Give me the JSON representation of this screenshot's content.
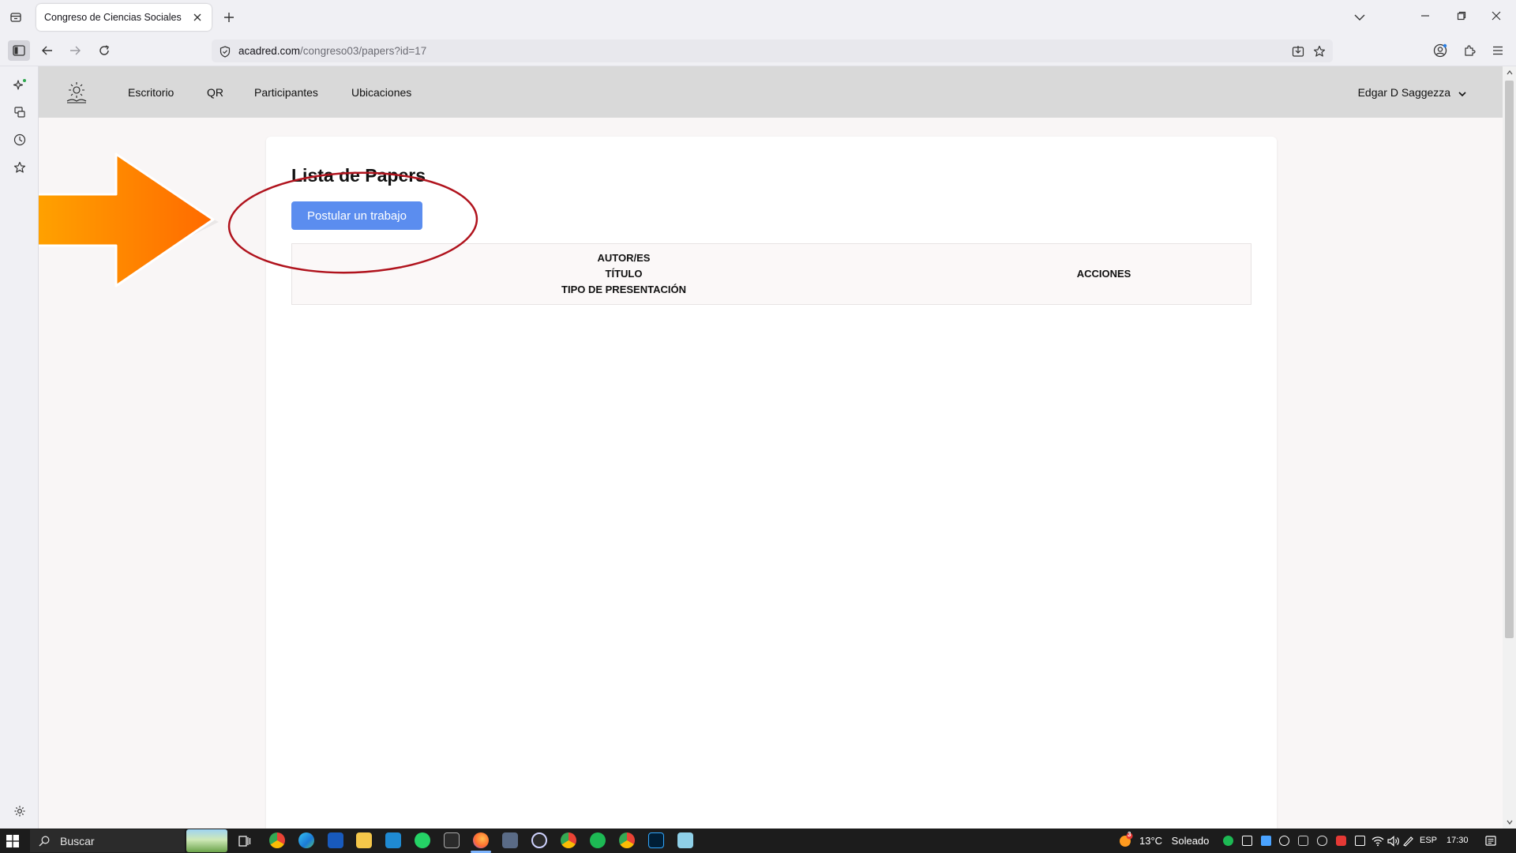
{
  "browser": {
    "tab_title": "Congreso de Ciencias Sociales",
    "url_host": "acadred.com",
    "url_path": "/congreso03/papers?id=17"
  },
  "site": {
    "nav": {
      "links": [
        "Escritorio",
        "QR",
        "Participantes",
        "Ubicaciones"
      ],
      "user_name": "Edgar D Saggezza"
    }
  },
  "page": {
    "title": "Lista de Papers",
    "apply_button": "Postular un trabajo",
    "table": {
      "col1_lines": [
        "AUTOR/ES",
        "TÍTULO",
        "TIPO DE PRESENTACIÓN"
      ],
      "col2": "ACCIONES"
    }
  },
  "taskbar": {
    "search_label": "Buscar",
    "weather_temp": "13°C",
    "weather_text": "Soleado",
    "weather_badge": "3",
    "language": "ESP",
    "time": "17:30"
  },
  "colors": {
    "primary_button": "#5b8def",
    "nav_bg": "#d9d9d9",
    "annotation_arrow": "#ff7300",
    "annotation_circle": "#b0131d"
  }
}
